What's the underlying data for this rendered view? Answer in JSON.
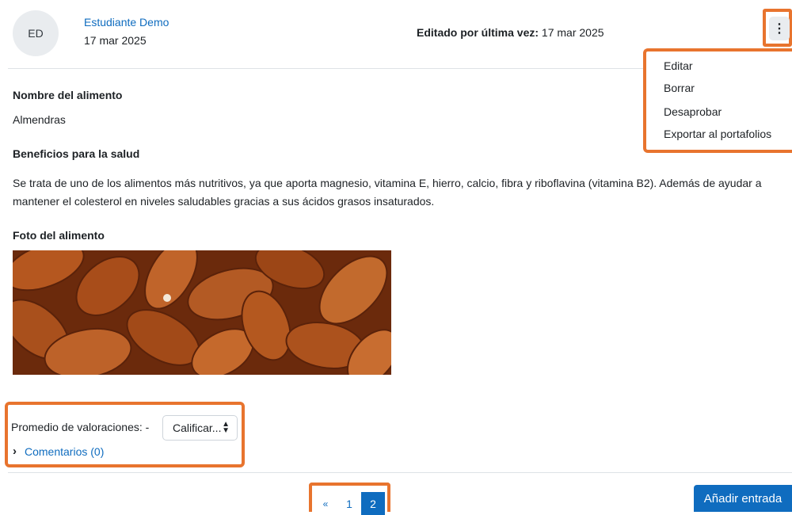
{
  "entry": {
    "author_initials": "ED",
    "author_name": "Estudiante Demo",
    "date": "17 mar 2025",
    "edited_label": "Editado por última vez:",
    "edited_date": "17 mar 2025"
  },
  "actions_menu": {
    "icon": "kebab-vertical-icon",
    "items": [
      "Editar",
      "Borrar",
      "Desaprobar",
      "Exportar al portafolios"
    ]
  },
  "fields": {
    "name_label": "Nombre del alimento",
    "name_value": "Almendras",
    "benefits_label": "Beneficios para la salud",
    "benefits_line1": "Se trata de uno de los alimentos más nutritivos, ya que aporta magnesio, vitamina E, hierro, calcio, fibra y riboflavina (vitamina B2). Además de ayudar a",
    "benefits_line2": "mantener el colesterol en niveles saludables gracias a sus ácidos grasos insaturados.",
    "photo_label": "Foto del alimento"
  },
  "rating": {
    "average_label": "Promedio de valoraciones: -",
    "select_value": "Calificar...",
    "comments_link": "Comentarios (0)"
  },
  "pagination": {
    "prev": "«",
    "pages": [
      "1",
      "2"
    ],
    "current": "2"
  },
  "add_entry_label": "Añadir entrada",
  "colors": {
    "highlight": "#e8742e",
    "link": "#0f6cbf",
    "primary_button": "#0f6cbf"
  }
}
